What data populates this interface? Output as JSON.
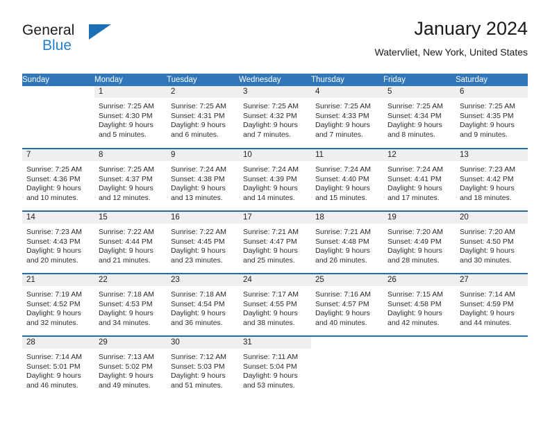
{
  "brand": {
    "name_part1": "General",
    "name_part2": "Blue",
    "logo_icon": "triangle-logo-icon"
  },
  "header": {
    "title": "January 2024",
    "subtitle": "Watervliet, New York, United States"
  },
  "colors": {
    "header_blue": "#3076b8",
    "row_divider_blue": "#1f6cb0",
    "daynum_band_gray": "#efefef",
    "brand_blue": "#1f7fd0",
    "text": "#1a1a1a"
  },
  "calendar": {
    "weekday_headers": [
      "Sunday",
      "Monday",
      "Tuesday",
      "Wednesday",
      "Thursday",
      "Friday",
      "Saturday"
    ],
    "weeks": [
      [
        {
          "day": "",
          "lines": []
        },
        {
          "day": "1",
          "lines": [
            "Sunrise: 7:25 AM",
            "Sunset: 4:30 PM",
            "Daylight: 9 hours",
            "and 5 minutes."
          ]
        },
        {
          "day": "2",
          "lines": [
            "Sunrise: 7:25 AM",
            "Sunset: 4:31 PM",
            "Daylight: 9 hours",
            "and 6 minutes."
          ]
        },
        {
          "day": "3",
          "lines": [
            "Sunrise: 7:25 AM",
            "Sunset: 4:32 PM",
            "Daylight: 9 hours",
            "and 7 minutes."
          ]
        },
        {
          "day": "4",
          "lines": [
            "Sunrise: 7:25 AM",
            "Sunset: 4:33 PM",
            "Daylight: 9 hours",
            "and 7 minutes."
          ]
        },
        {
          "day": "5",
          "lines": [
            "Sunrise: 7:25 AM",
            "Sunset: 4:34 PM",
            "Daylight: 9 hours",
            "and 8 minutes."
          ]
        },
        {
          "day": "6",
          "lines": [
            "Sunrise: 7:25 AM",
            "Sunset: 4:35 PM",
            "Daylight: 9 hours",
            "and 9 minutes."
          ]
        }
      ],
      [
        {
          "day": "7",
          "lines": [
            "Sunrise: 7:25 AM",
            "Sunset: 4:36 PM",
            "Daylight: 9 hours",
            "and 10 minutes."
          ]
        },
        {
          "day": "8",
          "lines": [
            "Sunrise: 7:25 AM",
            "Sunset: 4:37 PM",
            "Daylight: 9 hours",
            "and 12 minutes."
          ]
        },
        {
          "day": "9",
          "lines": [
            "Sunrise: 7:24 AM",
            "Sunset: 4:38 PM",
            "Daylight: 9 hours",
            "and 13 minutes."
          ]
        },
        {
          "day": "10",
          "lines": [
            "Sunrise: 7:24 AM",
            "Sunset: 4:39 PM",
            "Daylight: 9 hours",
            "and 14 minutes."
          ]
        },
        {
          "day": "11",
          "lines": [
            "Sunrise: 7:24 AM",
            "Sunset: 4:40 PM",
            "Daylight: 9 hours",
            "and 15 minutes."
          ]
        },
        {
          "day": "12",
          "lines": [
            "Sunrise: 7:24 AM",
            "Sunset: 4:41 PM",
            "Daylight: 9 hours",
            "and 17 minutes."
          ]
        },
        {
          "day": "13",
          "lines": [
            "Sunrise: 7:23 AM",
            "Sunset: 4:42 PM",
            "Daylight: 9 hours",
            "and 18 minutes."
          ]
        }
      ],
      [
        {
          "day": "14",
          "lines": [
            "Sunrise: 7:23 AM",
            "Sunset: 4:43 PM",
            "Daylight: 9 hours",
            "and 20 minutes."
          ]
        },
        {
          "day": "15",
          "lines": [
            "Sunrise: 7:22 AM",
            "Sunset: 4:44 PM",
            "Daylight: 9 hours",
            "and 21 minutes."
          ]
        },
        {
          "day": "16",
          "lines": [
            "Sunrise: 7:22 AM",
            "Sunset: 4:45 PM",
            "Daylight: 9 hours",
            "and 23 minutes."
          ]
        },
        {
          "day": "17",
          "lines": [
            "Sunrise: 7:21 AM",
            "Sunset: 4:47 PM",
            "Daylight: 9 hours",
            "and 25 minutes."
          ]
        },
        {
          "day": "18",
          "lines": [
            "Sunrise: 7:21 AM",
            "Sunset: 4:48 PM",
            "Daylight: 9 hours",
            "and 26 minutes."
          ]
        },
        {
          "day": "19",
          "lines": [
            "Sunrise: 7:20 AM",
            "Sunset: 4:49 PM",
            "Daylight: 9 hours",
            "and 28 minutes."
          ]
        },
        {
          "day": "20",
          "lines": [
            "Sunrise: 7:20 AM",
            "Sunset: 4:50 PM",
            "Daylight: 9 hours",
            "and 30 minutes."
          ]
        }
      ],
      [
        {
          "day": "21",
          "lines": [
            "Sunrise: 7:19 AM",
            "Sunset: 4:52 PM",
            "Daylight: 9 hours",
            "and 32 minutes."
          ]
        },
        {
          "day": "22",
          "lines": [
            "Sunrise: 7:18 AM",
            "Sunset: 4:53 PM",
            "Daylight: 9 hours",
            "and 34 minutes."
          ]
        },
        {
          "day": "23",
          "lines": [
            "Sunrise: 7:18 AM",
            "Sunset: 4:54 PM",
            "Daylight: 9 hours",
            "and 36 minutes."
          ]
        },
        {
          "day": "24",
          "lines": [
            "Sunrise: 7:17 AM",
            "Sunset: 4:55 PM",
            "Daylight: 9 hours",
            "and 38 minutes."
          ]
        },
        {
          "day": "25",
          "lines": [
            "Sunrise: 7:16 AM",
            "Sunset: 4:57 PM",
            "Daylight: 9 hours",
            "and 40 minutes."
          ]
        },
        {
          "day": "26",
          "lines": [
            "Sunrise: 7:15 AM",
            "Sunset: 4:58 PM",
            "Daylight: 9 hours",
            "and 42 minutes."
          ]
        },
        {
          "day": "27",
          "lines": [
            "Sunrise: 7:14 AM",
            "Sunset: 4:59 PM",
            "Daylight: 9 hours",
            "and 44 minutes."
          ]
        }
      ],
      [
        {
          "day": "28",
          "lines": [
            "Sunrise: 7:14 AM",
            "Sunset: 5:01 PM",
            "Daylight: 9 hours",
            "and 46 minutes."
          ]
        },
        {
          "day": "29",
          "lines": [
            "Sunrise: 7:13 AM",
            "Sunset: 5:02 PM",
            "Daylight: 9 hours",
            "and 49 minutes."
          ]
        },
        {
          "day": "30",
          "lines": [
            "Sunrise: 7:12 AM",
            "Sunset: 5:03 PM",
            "Daylight: 9 hours",
            "and 51 minutes."
          ]
        },
        {
          "day": "31",
          "lines": [
            "Sunrise: 7:11 AM",
            "Sunset: 5:04 PM",
            "Daylight: 9 hours",
            "and 53 minutes."
          ]
        },
        {
          "day": "",
          "lines": []
        },
        {
          "day": "",
          "lines": []
        },
        {
          "day": "",
          "lines": []
        }
      ]
    ]
  }
}
